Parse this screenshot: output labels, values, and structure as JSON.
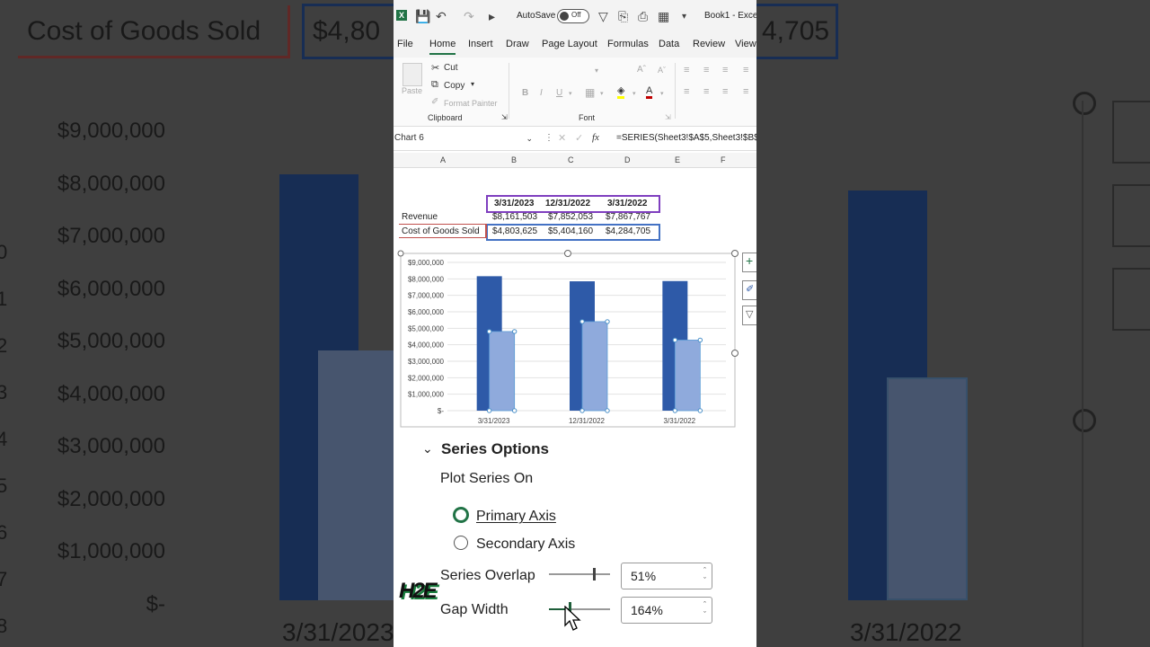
{
  "colors": {
    "revenue": "#2e5aa8",
    "cogs": "#8faadc",
    "accent": "#217346"
  },
  "bg_zoom": {
    "row_label": "Cost of Goods Sold",
    "cell_partial_1": "$4,80",
    "cell_partial_2": "4,705",
    "ticks": [
      "$9,000,000",
      "$8,000,000",
      "$7,000,000",
      "$6,000,000",
      "$5,000,000",
      "$4,000,000",
      "$3,000,000",
      "$2,000,000",
      "$1,000,000",
      "$-"
    ],
    "x_left": "3/31/2023",
    "x_right": "3/31/2022",
    "row_nums": [
      "0",
      "1",
      "2",
      "3",
      "4",
      "5",
      "6",
      "7",
      "8"
    ]
  },
  "qat": {
    "autosave_label": "AutoSave",
    "autosave_state": "Off",
    "title": "Book1 - Exce"
  },
  "ribbon_tabs": [
    "File",
    "Home",
    "Insert",
    "Draw",
    "Page Layout",
    "Formulas",
    "Data",
    "Review",
    "View"
  ],
  "ribbon": {
    "paste": "Paste",
    "cut": "Cut",
    "copy": "Copy",
    "format_painter": "Format Painter",
    "clipboard": "Clipboard",
    "font": "Font"
  },
  "formula_bar": {
    "name_box": "Chart 6",
    "formula": "=SERIES(Sheet3!$A$5,Sheet3!$B$"
  },
  "columns": [
    "A",
    "B",
    "C",
    "D",
    "E",
    "F"
  ],
  "sheet": {
    "headers": [
      "3/31/2023",
      "12/31/2022",
      "3/31/2022"
    ],
    "rows": [
      {
        "label": "Revenue",
        "values": [
          "$8,161,503",
          "$7,852,053",
          "$7,867,767"
        ]
      },
      {
        "label": "Cost of Goods Sold",
        "values": [
          "$4,803,625",
          "$5,404,160",
          "$4,284,705"
        ]
      }
    ]
  },
  "chart_data": {
    "type": "bar",
    "categories": [
      "3/31/2023",
      "12/31/2022",
      "3/31/2022"
    ],
    "series": [
      {
        "name": "Revenue",
        "values": [
          8161503,
          7852053,
          7867767
        ]
      },
      {
        "name": "Cost of Goods Sold",
        "values": [
          4803625,
          5404160,
          4284705
        ]
      }
    ],
    "ylim": [
      0,
      9000000
    ],
    "y_ticks": [
      "$9,000,000",
      "$8,000,000",
      "$7,000,000",
      "$6,000,000",
      "$5,000,000",
      "$4,000,000",
      "$3,000,000",
      "$2,000,000",
      "$1,000,000",
      "$-"
    ],
    "grid": true,
    "series_overlap_pct": 51,
    "gap_width_pct": 164
  },
  "pane": {
    "section": "Series Options",
    "plot_on": "Plot Series On",
    "primary": "Primary Axis",
    "secondary": "Secondary Axis",
    "overlap_label": "Series Overlap",
    "overlap_value": "51%",
    "gap_label": "Gap Width",
    "gap_value": "164%",
    "logo": "H2E"
  }
}
